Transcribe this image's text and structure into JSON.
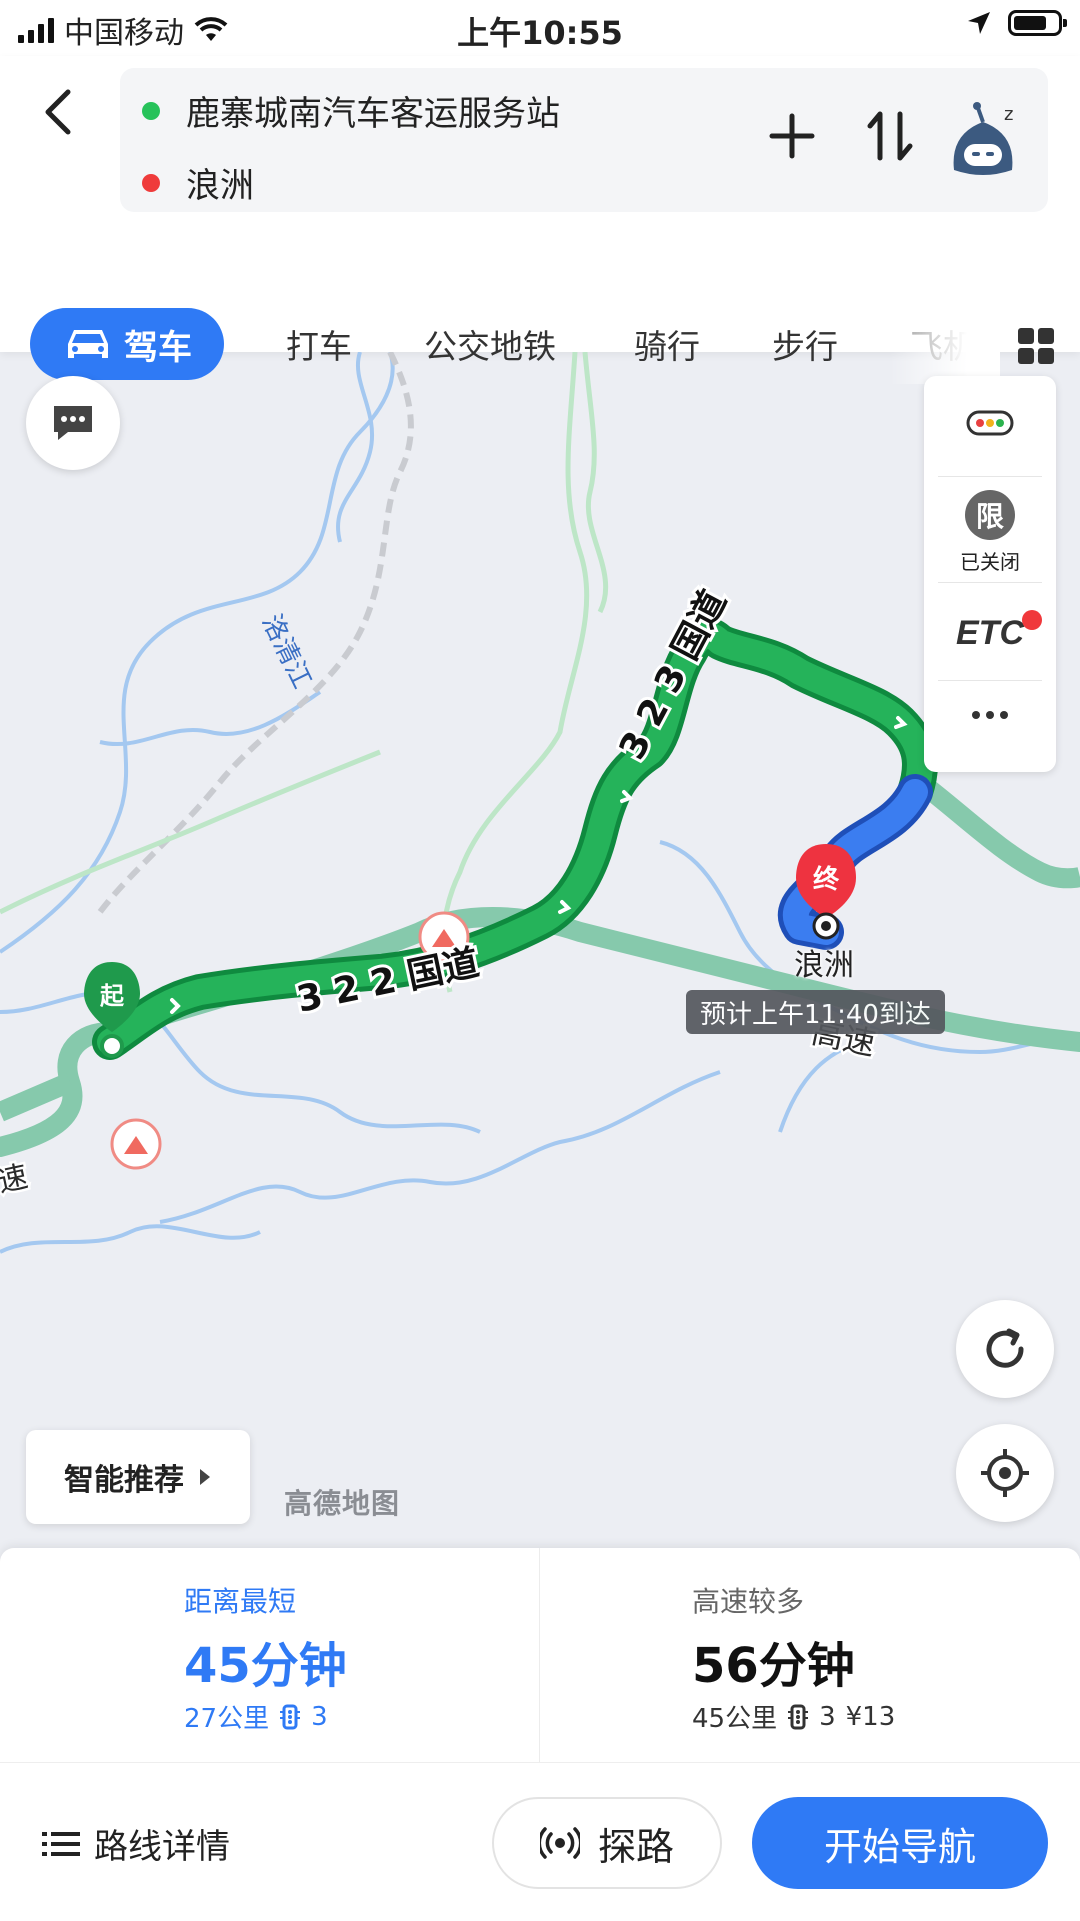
{
  "status_bar": {
    "carrier": "中国移动",
    "time": "上午10:55"
  },
  "route": {
    "origin": "鹿寨城南汽车客运服务站",
    "destination": "浪洲"
  },
  "modes": {
    "active": "驾车",
    "items": [
      "打车",
      "公交地铁",
      "骑行",
      "步行",
      "飞机"
    ]
  },
  "side_panel": {
    "limit_badge": "限",
    "limit_status": "已关闭",
    "etc": "ETC"
  },
  "map": {
    "road_label_1": "3 2 2 国道",
    "road_label_2": "3 2 3 国道",
    "highway_label": "高速",
    "highway_label_2": "速",
    "river_label": "洛清江",
    "start_marker": "起",
    "end_marker": "终",
    "destination_label": "浪洲",
    "eta": "预计上午11:40到达",
    "smart_button": "智能推荐",
    "logo": "高德地图"
  },
  "routes": [
    {
      "label": "距离最短",
      "duration": "45分钟",
      "distance": "27公里",
      "lights": "3"
    },
    {
      "label": "高速较多",
      "duration": "56分钟",
      "distance": "45公里",
      "lights": "3",
      "toll": "¥13"
    }
  ],
  "bottom": {
    "detail": "路线详情",
    "explore": "探路",
    "navigate": "开始导航"
  },
  "colors": {
    "accent": "#2f7af5",
    "route_green": "#1fad5c",
    "highway": "#86c9ac",
    "river": "#9cc3ee"
  }
}
